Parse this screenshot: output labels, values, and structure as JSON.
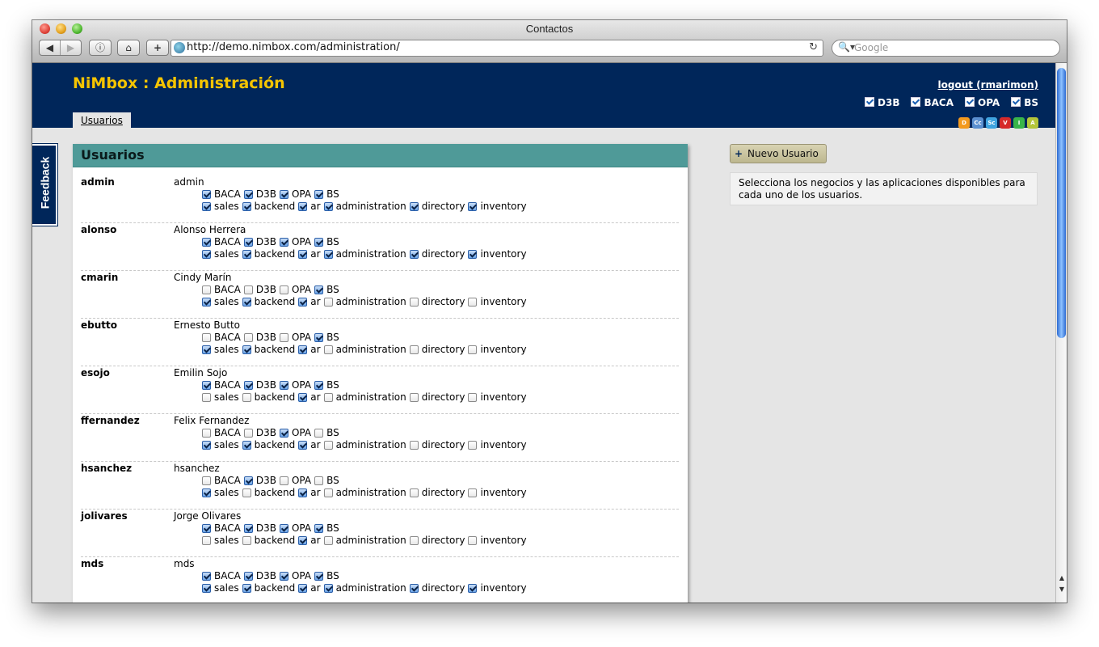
{
  "window": {
    "title": "Contactos"
  },
  "toolbar": {
    "back_icon": "◀",
    "forward_icon": "▶",
    "info_icon": "ⓘ",
    "home_icon": "⌂",
    "add_icon": "+",
    "url": "http://demo.nimbox.com/administration/",
    "reload_icon": "↻",
    "search_icon": "🔍▾",
    "search_placeholder": "Google"
  },
  "header": {
    "title": "NiMbox : Administración",
    "logout": "logout (rmarimon)",
    "businesses": [
      "D3B",
      "BACA",
      "OPA",
      "BS"
    ],
    "app_icons": [
      {
        "label": "D",
        "color": "#f39a1e"
      },
      {
        "label": "Cc",
        "color": "#5a8fd0"
      },
      {
        "label": "Sc",
        "color": "#3fa4e0"
      },
      {
        "label": "V",
        "color": "#d62a2a"
      },
      {
        "label": "I",
        "color": "#39b54a"
      },
      {
        "label": "A",
        "color": "#b4c63a"
      }
    ],
    "tab": "Usuarios"
  },
  "feedback": "Feedback",
  "panel": {
    "title": "Usuarios",
    "business_labels": [
      "BACA",
      "D3B",
      "OPA",
      "BS"
    ],
    "app_labels": [
      "sales",
      "backend",
      "ar",
      "administration",
      "directory",
      "inventory"
    ],
    "users": [
      {
        "username": "admin",
        "name": "admin",
        "biz": [
          true,
          true,
          true,
          true
        ],
        "apps": [
          true,
          true,
          true,
          true,
          true,
          true
        ]
      },
      {
        "username": "alonso",
        "name": "Alonso Herrera",
        "biz": [
          true,
          true,
          true,
          true
        ],
        "apps": [
          true,
          true,
          true,
          true,
          true,
          true
        ]
      },
      {
        "username": "cmarin",
        "name": "Cindy Marín",
        "biz": [
          false,
          false,
          false,
          true
        ],
        "apps": [
          true,
          true,
          true,
          false,
          false,
          false
        ]
      },
      {
        "username": "ebutto",
        "name": "Ernesto Butto",
        "biz": [
          false,
          false,
          false,
          true
        ],
        "apps": [
          true,
          true,
          true,
          false,
          false,
          false
        ]
      },
      {
        "username": "esojo",
        "name": "Emilin Sojo",
        "biz": [
          true,
          true,
          true,
          true
        ],
        "apps": [
          false,
          false,
          true,
          false,
          false,
          false
        ]
      },
      {
        "username": "ffernandez",
        "name": "Felix Fernandez",
        "biz": [
          false,
          false,
          true,
          false
        ],
        "apps": [
          true,
          true,
          true,
          false,
          false,
          false
        ]
      },
      {
        "username": "hsanchez",
        "name": "hsanchez",
        "biz": [
          false,
          true,
          false,
          false
        ],
        "apps": [
          true,
          false,
          true,
          false,
          false,
          false
        ]
      },
      {
        "username": "jolivares",
        "name": "Jorge Olivares",
        "biz": [
          true,
          true,
          true,
          true
        ],
        "apps": [
          false,
          false,
          true,
          false,
          false,
          false
        ]
      },
      {
        "username": "mds",
        "name": "mds",
        "biz": [
          true,
          true,
          true,
          true
        ],
        "apps": [
          true,
          true,
          true,
          true,
          true,
          true
        ]
      }
    ]
  },
  "sidebar": {
    "new_user_icon": "+",
    "new_user": "Nuevo Usuario",
    "info": "Selecciona los negocios y las aplicaciones disponibles para cada uno de los usuarios."
  },
  "scrollbar": {
    "up_icon": "▲",
    "down_icon": "▼"
  }
}
